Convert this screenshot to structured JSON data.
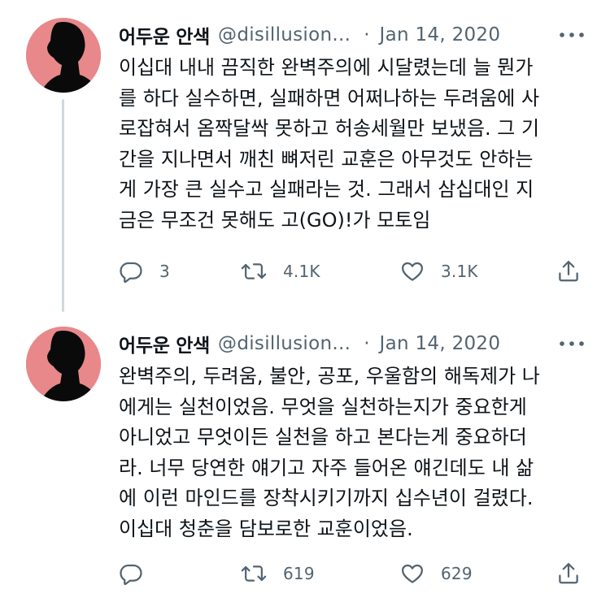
{
  "tweets": [
    {
      "author": {
        "display_name": "어두운 안색",
        "handle": "@disillusion...",
        "avatar_bg": "#e8888a"
      },
      "separator": "·",
      "date": "Jan 14, 2020",
      "text_lines": [
        "이십대 내내 끔직한 완벽주의에 시달렸는데 늘 뭔가",
        "를 하다 실수하면, 실패하면 어쩌나하는 두려움에 사",
        "로잡혀서 옴짝달싹 못하고 허송세월만 보냈음. 그 기",
        "간을 지나면서 깨친 뼈저린 교훈은 아무것도 안하는",
        "게 가장 큰 실수고 실패라는 것. 그래서 삼십대인 지",
        "금은 무조건 못해도 고(GO)!가 모토임"
      ],
      "actions": {
        "reply_icon": "reply-icon",
        "reply_count": "3",
        "retweet_icon": "retweet-icon",
        "retweet_count": "4.1K",
        "like_icon": "heart-icon",
        "like_count": "3.1K",
        "share_icon": "share-icon"
      }
    },
    {
      "author": {
        "display_name": "어두운 안색",
        "handle": "@disillusion...",
        "avatar_bg": "#e8888a"
      },
      "separator": "·",
      "date": "Jan 14, 2020",
      "text_lines": [
        "완벽주의, 두려움, 불안, 공포, 우울함의 해독제가 나",
        "에게는 실천이었음. 무엇을 실천하는지가 중요한게",
        "아니었고 무엇이든 실천을 하고 본다는게 중요하더",
        "라. 너무 당연한 얘기고 자주 들어온 얘긴데도 내 삶",
        "에 이런 마인드를 장착시키기까지 십수년이 걸렸다.",
        "이십대 청춘을 담보로한 교훈이었음."
      ],
      "actions": {
        "reply_icon": "reply-icon",
        "reply_count": "",
        "retweet_icon": "retweet-icon",
        "retweet_count": "619",
        "like_icon": "heart-icon",
        "like_count": "629",
        "share_icon": "share-icon"
      }
    }
  ],
  "colors": {
    "text_primary": "#0f1419",
    "text_secondary": "#536471",
    "thread_line": "#cfd9de",
    "avatar_bg": "#e8888a",
    "avatar_silhouette": "#0a0a0a"
  }
}
